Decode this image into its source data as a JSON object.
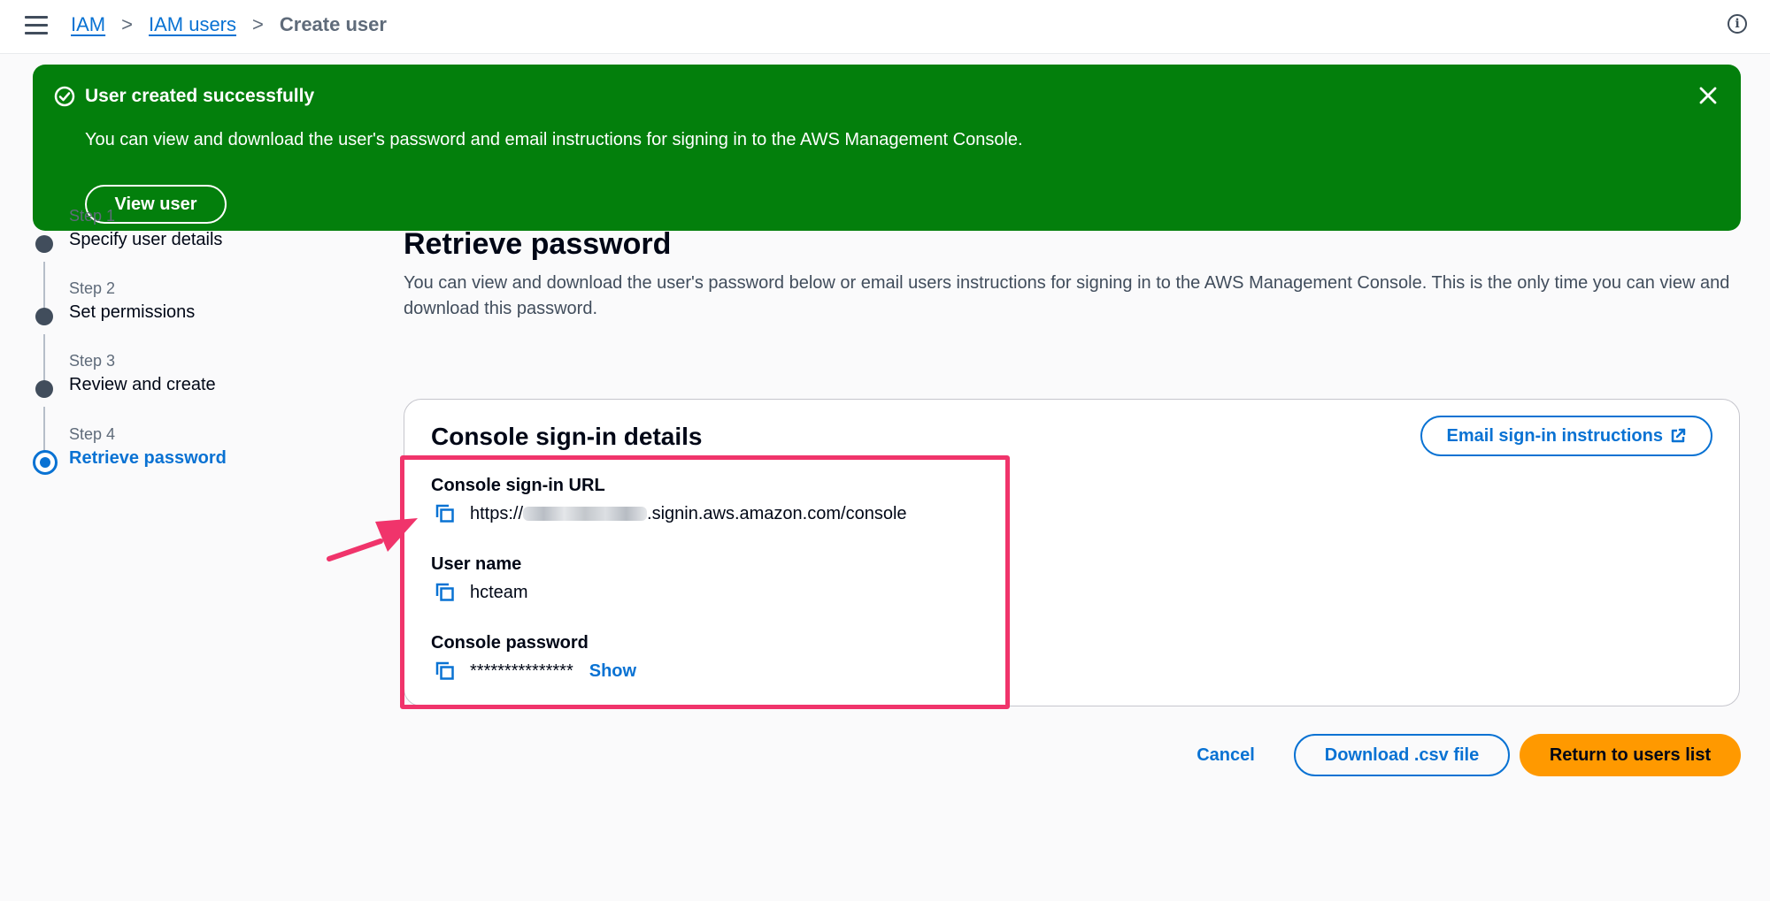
{
  "breadcrumb": {
    "items": [
      "IAM",
      "IAM users"
    ],
    "current": "Create user",
    "separator": ">"
  },
  "icons": {
    "menu": "hamburger-icon",
    "info": "info-icon",
    "success": "check-circle-icon",
    "close": "close-icon",
    "external": "external-link-icon",
    "copy": "copy-icon"
  },
  "flash": {
    "title": "User created successfully",
    "message": "You can view and download the user's password and email instructions for signing in to the AWS Management Console.",
    "button": "View user",
    "color": "#037f0c"
  },
  "steps": [
    {
      "number": "Step 1",
      "title": "Specify user details"
    },
    {
      "number": "Step 2",
      "title": "Set permissions"
    },
    {
      "number": "Step 3",
      "title": "Review and create"
    },
    {
      "number": "Step 4",
      "title": "Retrieve password",
      "active": true
    }
  ],
  "page": {
    "title": "Retrieve password",
    "description": "You can view and download the user's password below or email users instructions for signing in to the AWS Management Console. This is the only time you can view and download this password."
  },
  "card": {
    "title": "Console sign-in details",
    "email_button": "Email sign-in instructions",
    "fields": {
      "url_label": "Console sign-in URL",
      "url_prefix": "https://",
      "url_suffix": ".signin.aws.amazon.com/console",
      "username_label": "User name",
      "username_value": "hcteam",
      "password_label": "Console password",
      "password_value": "***************",
      "show_link": "Show"
    }
  },
  "actions": {
    "cancel": "Cancel",
    "download": "Download .csv file",
    "return": "Return to users list"
  },
  "colors": {
    "accent": "#0972d3",
    "primary_button": "#ff9900",
    "highlight": "#f0346b"
  }
}
